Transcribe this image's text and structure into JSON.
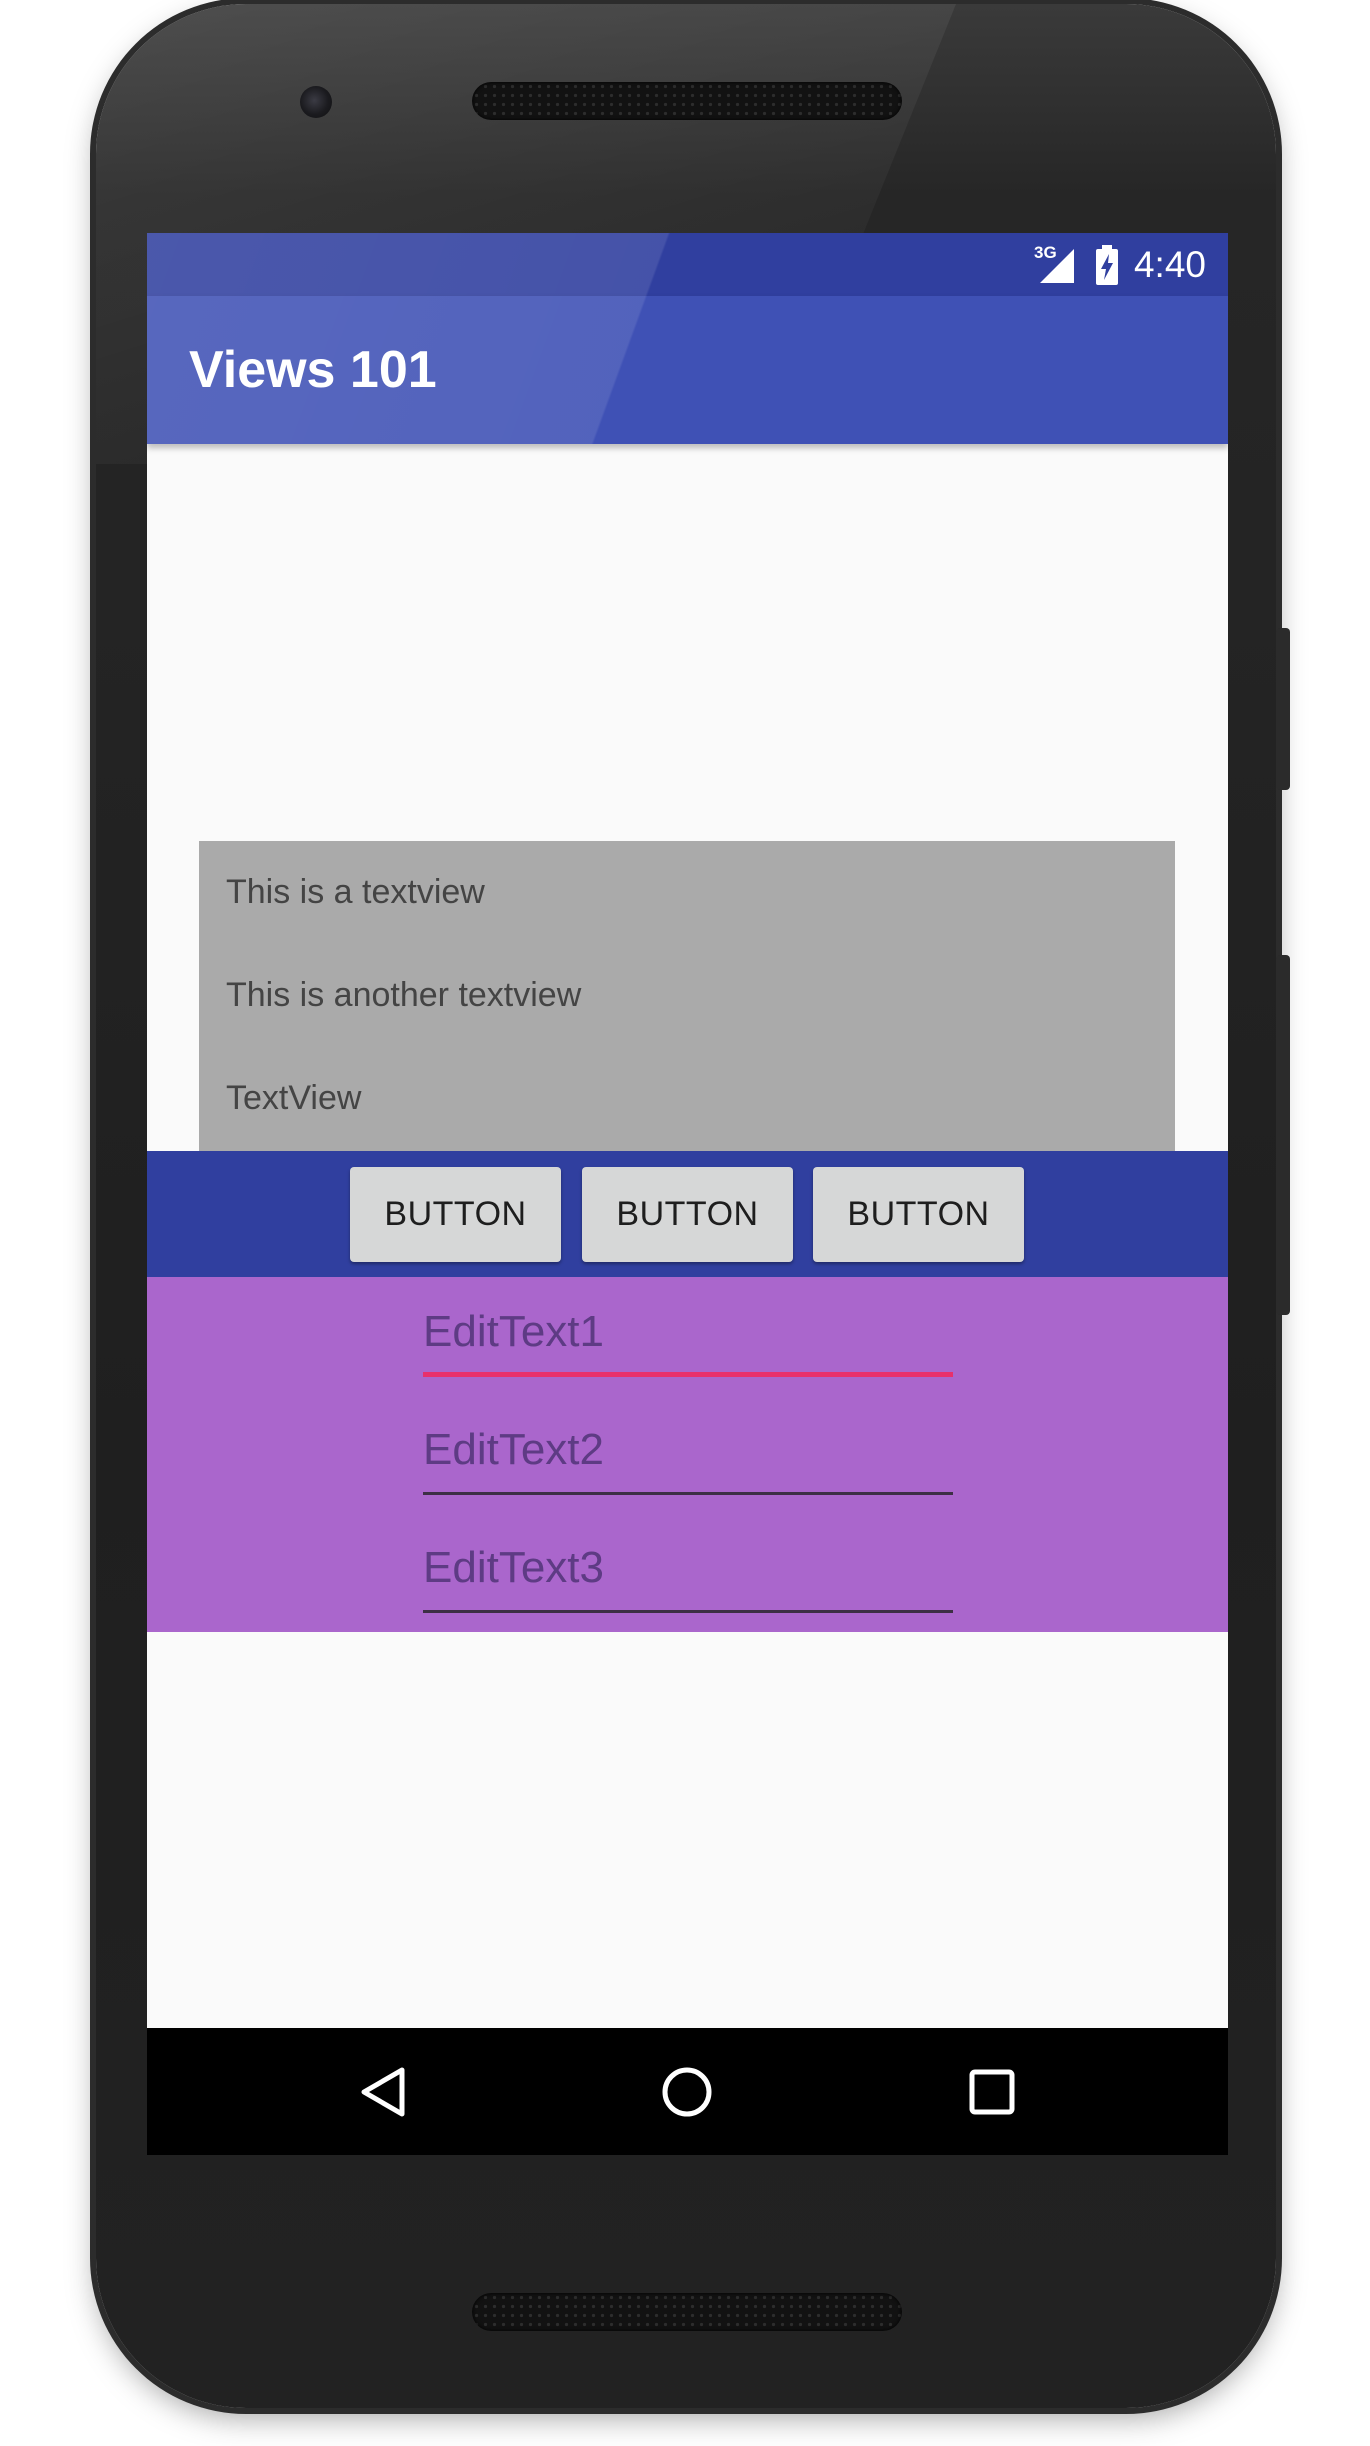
{
  "status_bar": {
    "network": "3G",
    "time": "4:40",
    "icons": [
      "signal-icon",
      "battery-charging-icon"
    ]
  },
  "app_bar": {
    "title": "Views 101"
  },
  "textviews": [
    {
      "text": "This is a textview"
    },
    {
      "text": "This is another textview"
    },
    {
      "text": "TextView"
    }
  ],
  "buttons": [
    {
      "label": "BUTTON"
    },
    {
      "label": "BUTTON"
    },
    {
      "label": "BUTTON"
    }
  ],
  "edit_texts": [
    {
      "value": "EditText1",
      "focused": true
    },
    {
      "value": "EditText2",
      "focused": false
    },
    {
      "value": "EditText3",
      "focused": false
    }
  ],
  "nav_bar": {
    "icons": [
      "back-icon",
      "home-icon",
      "recents-icon"
    ]
  },
  "colors": {
    "primary": "#3f51b5",
    "primary_dark": "#303f9f",
    "accent": "#e8306c",
    "textview_background": "#aaaaaa",
    "edittext_background": "#aa66cc",
    "screen_background": "#fafafa"
  }
}
